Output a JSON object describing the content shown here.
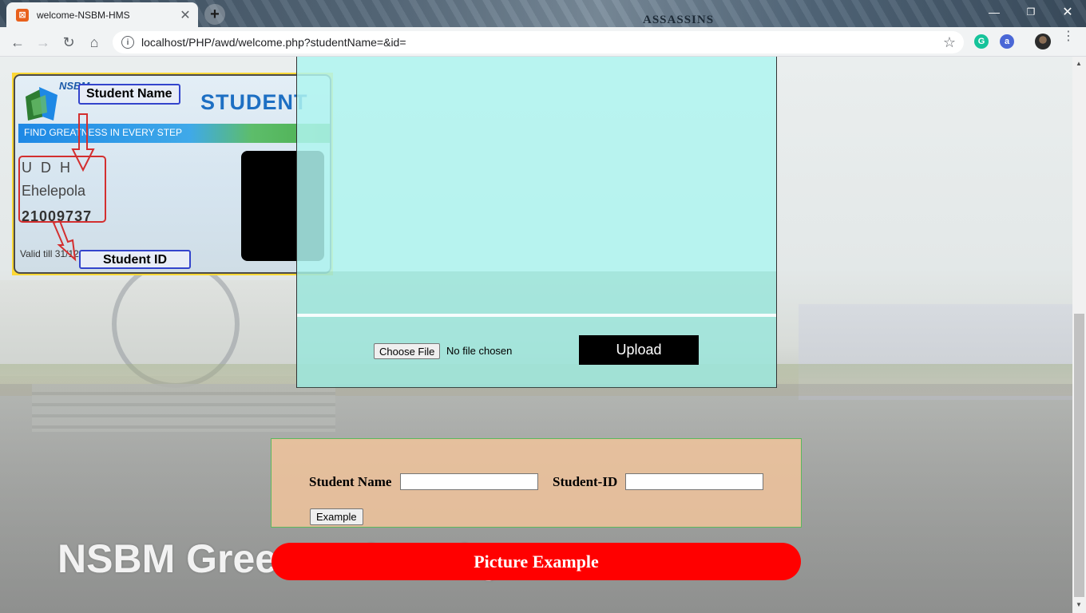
{
  "browser": {
    "tab_title": "welcome-NSBM-HMS",
    "tab_favicon": "xampp-icon",
    "tab_close": "✕",
    "new_tab": "+",
    "theme_logo": "ASSASSINS",
    "window_min": "—",
    "window_max": "❐",
    "window_close": "✕",
    "url": "localhost/PHP/awd/welcome.php?studentName=&id=",
    "nav_back": "←",
    "nav_forward": "→",
    "nav_reload": "↻",
    "nav_home": "⌂",
    "bookmark_star": "☆",
    "ext_grammarly": "G",
    "ext_a": "a",
    "info_icon": "i",
    "menu": "⋮"
  },
  "id_card": {
    "brand": "NSBM",
    "title": "STUDENT",
    "stripe_text": "FIND GREATNESS IN EVERY STEP",
    "line1": "U D H",
    "line2": "Ehelepola",
    "line3": "21009737",
    "valid": "Valid till 31/12/2022",
    "label_name": "Student Name",
    "label_id": "Student ID"
  },
  "upload": {
    "choose_file": "Choose File",
    "no_file": "No file chosen",
    "upload_button": "Upload"
  },
  "form": {
    "name_label": "Student Name",
    "name_value": "",
    "id_label": "Student-ID",
    "id_value": "",
    "example_button": "Example"
  },
  "picture_example_button": "Picture Example",
  "background_text": "NSBM Green University",
  "scrollbar": {
    "up": "▲",
    "down": "▼"
  },
  "colors": {
    "upload_panel": "#aff5f0",
    "form_panel": "#f0c39b",
    "picture_button": "#ff0000",
    "upload_button": "#000000"
  }
}
